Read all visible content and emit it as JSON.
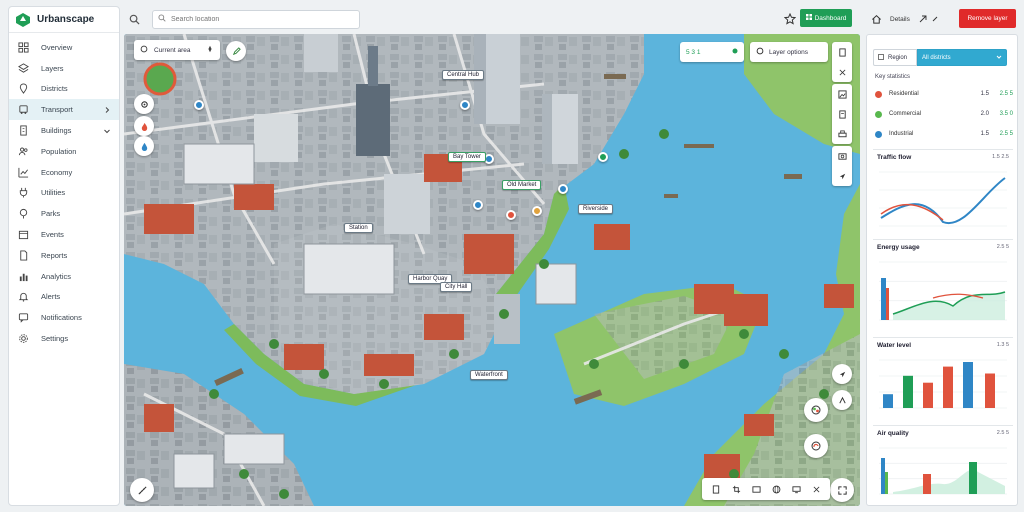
{
  "app": {
    "name": "Urbanscape"
  },
  "sidebar": {
    "items": [
      {
        "label": "Overview",
        "icon": "dashboard-icon"
      },
      {
        "label": "Layers",
        "icon": "layers-icon"
      },
      {
        "label": "Districts",
        "icon": "map-pin-icon"
      },
      {
        "label": "Transport",
        "icon": "bus-icon",
        "active": true,
        "chevron": "right"
      },
      {
        "label": "Buildings",
        "icon": "building-icon",
        "chevron": "down"
      },
      {
        "label": "Population",
        "icon": "people-icon"
      },
      {
        "label": "Economy",
        "icon": "chart-icon"
      },
      {
        "label": "Utilities",
        "icon": "plug-icon"
      },
      {
        "label": "Parks",
        "icon": "tree-icon"
      },
      {
        "label": "Events",
        "icon": "calendar-icon"
      },
      {
        "label": "Reports",
        "icon": "document-icon"
      },
      {
        "label": "Analytics",
        "icon": "bar-chart-icon"
      },
      {
        "label": "Alerts",
        "icon": "bell-icon"
      },
      {
        "label": "Notifications",
        "icon": "message-icon"
      },
      {
        "label": "Settings",
        "icon": "gear-icon"
      }
    ]
  },
  "topbar": {
    "search_placeholder": "Search location",
    "primary_label": "Dashboard"
  },
  "map": {
    "pill_left": "Current area",
    "pill_top_right_count": "5 3 1",
    "pill_top_right_label": "Layer options",
    "labels": [
      "Central Hub",
      "Bay Tower",
      "Old Market",
      "Riverside",
      "Station",
      "Harbor Quay",
      "City Hall",
      "Waterfront"
    ]
  },
  "right": {
    "breadcrumb": "Details",
    "danger_label": "Remove layer",
    "filter_key": "Region",
    "filter_value": "All districts",
    "legend_title": "Key statistics",
    "legend": [
      {
        "name": "Residential",
        "color": "#e0533d",
        "v1": "1.5",
        "v2": "2.5 5"
      },
      {
        "name": "Commercial",
        "color": "#59b84e",
        "v1": "2.0",
        "v2": "3.5 0"
      },
      {
        "name": "Industrial",
        "color": "#2f86c6",
        "v1": "1.5",
        "v2": "2.5 5"
      }
    ],
    "cards": [
      {
        "title": "Traffic flow",
        "meta": "1.5 2.5"
      },
      {
        "title": "Energy usage",
        "meta": "2.5 5"
      },
      {
        "title": "Water level",
        "meta": "1.3 5"
      },
      {
        "title": "Air quality",
        "meta": "2.5 5"
      }
    ]
  },
  "colors": {
    "accent": "#1f9e56",
    "danger": "#e02a2a",
    "select": "#31a9d0",
    "water": "#5cb4dc",
    "land": "#8fc46a",
    "road": "#cfcfcf",
    "roof_red": "#c4543a",
    "roof_gray": "#8e969c"
  }
}
